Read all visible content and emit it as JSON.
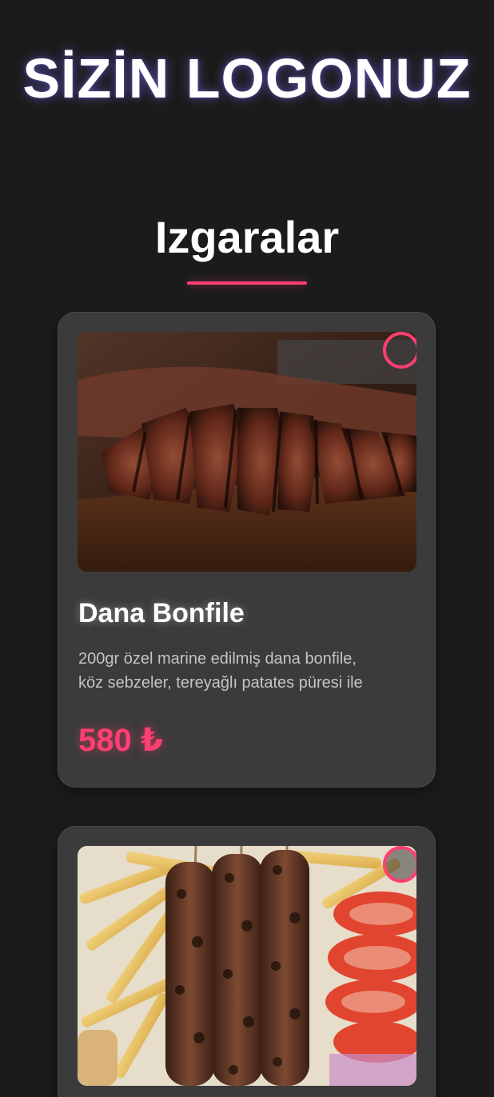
{
  "header": {
    "logo_text": "SİZİN LOGONUZ"
  },
  "section": {
    "title": "Izgaralar"
  },
  "colors": {
    "background": "#1b1b1b",
    "card": "#3b3b3b",
    "accent": "#ff3e72"
  },
  "items": [
    {
      "name": "Dana Bonfile",
      "description_line1": "200gr özel marine edilmiş dana bonfile,",
      "description_line2": "köz sebzeler, tereyağlı patates püresi ile",
      "price": "580 ₺",
      "favorite_icon": "heart-outline-icon",
      "image": "sliced-steak-photo"
    },
    {
      "favorite_icon": "heart-outline-icon",
      "image": "skewers-fries-tomato-photo"
    }
  ]
}
